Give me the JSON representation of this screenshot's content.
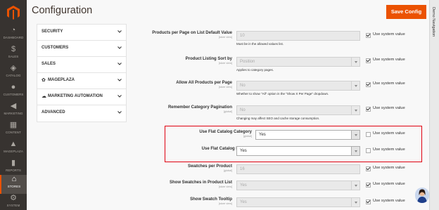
{
  "nav": {
    "items": [
      {
        "label": "DASHBOARD",
        "icon": "speedometer-icon"
      },
      {
        "label": "SALES",
        "icon": "dollar-icon"
      },
      {
        "label": "CATALOG",
        "icon": "box-icon"
      },
      {
        "label": "CUSTOMERS",
        "icon": "user-icon"
      },
      {
        "label": "MARKETING",
        "icon": "megaphone-icon"
      },
      {
        "label": "CONTENT",
        "icon": "layout-icon"
      },
      {
        "label": "MAGEPLAZA",
        "icon": "mageplaza-icon"
      },
      {
        "label": "REPORTS",
        "icon": "bar-chart-icon"
      },
      {
        "label": "STORES",
        "icon": "store-icon"
      },
      {
        "label": "SYSTEM",
        "icon": "gear-icon"
      }
    ]
  },
  "header": {
    "title": "Configuration",
    "save_label": "Save Config"
  },
  "demo_nav_label": "Demo Navigation",
  "tabs": [
    {
      "label": "SECURITY"
    },
    {
      "label": "CUSTOMERS"
    },
    {
      "label": "SALES"
    },
    {
      "label": "MAGEPLAZA"
    },
    {
      "label": "MARKETING AUTOMATION"
    },
    {
      "label": "ADVANCED"
    }
  ],
  "rows": {
    "products_per_page": {
      "label": "Products per Page on List Default Value",
      "scope": "[store view]",
      "value": "10",
      "note": "Must be in the allowed values list.",
      "system": "Use system value"
    },
    "sort_by": {
      "label": "Product Listing Sort by",
      "scope": "[store view]",
      "value": "Position",
      "note": "Applies to category pages.",
      "system": "Use system value"
    },
    "allow_all": {
      "label": "Allow All Products per Page",
      "scope": "[store view]",
      "value": "No",
      "note": "Whether to show \"All\" option in the \"Show X Per Page\" dropdown.",
      "system": "Use system value"
    },
    "pagination": {
      "label": "Remember Category Pagination",
      "scope": "[global]",
      "value": "No",
      "note": "Changing may affect SEO and cache storage consumption.",
      "system": "Use system value"
    },
    "flat_category": {
      "label": "Use Flat Catalog Category",
      "scope": "[global]",
      "value": "Yes",
      "system": "Use system value"
    },
    "flat_product": {
      "label": "Use Flat Catalog Product",
      "scope": "[global]",
      "value": "Yes",
      "system": "Use system value"
    },
    "swatches": {
      "label": "Swatches per Product",
      "scope": "[global]",
      "value": "16",
      "system": "Use system value"
    },
    "swatches_list": {
      "label": "Show Swatches in Product List",
      "scope": "[store view]",
      "value": "Yes",
      "system": "Use system value"
    },
    "swatch_tooltip": {
      "label": "Show Swatch Tooltip",
      "scope": "[store view]",
      "value": "Yes",
      "system": "Use system value"
    }
  },
  "colors": {
    "accent": "#eb5202",
    "nav_bg": "#373330",
    "highlight": "#e0000f"
  }
}
